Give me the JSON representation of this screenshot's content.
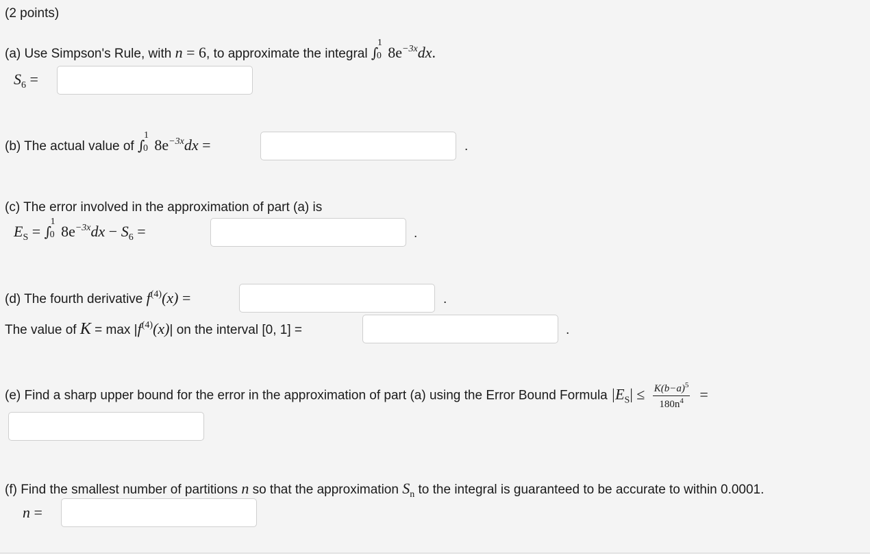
{
  "points": "(2 points)",
  "part_a": {
    "text_before": "(a) Use Simpson's Rule, with ",
    "n_var": "n",
    "eq": " = ",
    "n_val": "6",
    "text_after": ", to approximate the integral ",
    "int_upper": "1",
    "int_lower": "0",
    "integrand_coef": "8e",
    "integrand_exp": "−3x",
    "dx": "dx",
    "period": ".",
    "label_var": "S",
    "label_sub": "6",
    "label_eq": " =",
    "answer": ""
  },
  "part_b": {
    "text": "(b) The actual value of ",
    "int_upper": "1",
    "int_lower": "0",
    "integrand_coef": "8e",
    "integrand_exp": "−3x",
    "dx": "dx",
    "eq": " =",
    "answer": "",
    "period": "."
  },
  "part_c": {
    "text": "(c) The error involved in the approximation of part (a) is",
    "lhs_var": "E",
    "lhs_sub": "S",
    "eq1": " = ",
    "int_upper": "1",
    "int_lower": "0",
    "integrand_coef": "8e",
    "integrand_exp": "−3x",
    "dx": "dx",
    "minus": " − ",
    "s_var": "S",
    "s_sub": "6",
    "eq2": " =",
    "answer": "",
    "period": "."
  },
  "part_d": {
    "text": "(d) The fourth derivative ",
    "f": "f",
    "f_sup": "(4)",
    "arg": "(x)",
    "eq": " =",
    "answer1": "",
    "period1": ".",
    "k_text1": "The value of ",
    "k_var": "K",
    "k_text2": " = max |",
    "k_f": "f",
    "k_sup": "(4)",
    "k_arg": "(x)",
    "k_text3": "| on the interval [0, 1] =",
    "answer2": "",
    "period2": "."
  },
  "part_e": {
    "text": "(e) Find a sharp upper bound for the error in the approximation of part (a) using the Error Bound Formula ",
    "abs_var": "|E",
    "abs_sub": "S",
    "abs_close": "|",
    "le": " ≤ ",
    "frac_num": "K(b−a)",
    "frac_num_sup": "5",
    "frac_den": "180n",
    "frac_den_sup": "4",
    "eq": "=",
    "answer": ""
  },
  "part_f": {
    "text1": "(f) Find the smallest number of partitions ",
    "n_var": "n",
    "text2": " so that the approximation ",
    "s_var": "S",
    "s_sub": "n",
    "text3": " to the integral is guaranteed to be accurate to within 0.0001.",
    "label_var": "n",
    "label_eq": " =",
    "answer": ""
  }
}
